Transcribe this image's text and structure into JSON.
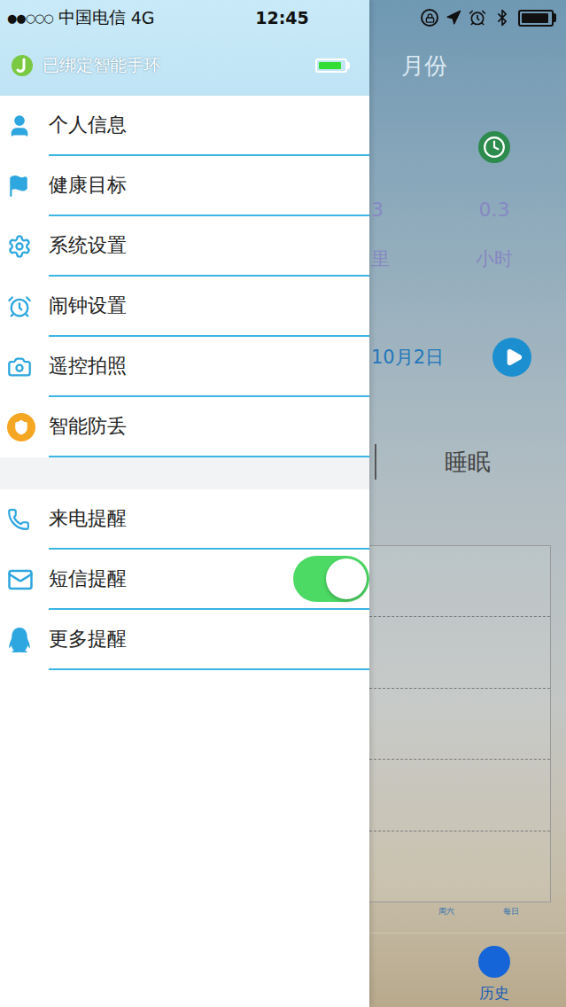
{
  "status_bar": {
    "signal": "●●○○○",
    "carrier": "中国电信",
    "network": "4G",
    "time": "12:45",
    "battery_level": 0.95
  },
  "drawer": {
    "header": {
      "label": "已绑定智能手环",
      "battery_level": 0.9
    },
    "sections": [
      {
        "items": [
          {
            "label": "个人信息",
            "kind": "link"
          },
          {
            "label": "健康目标",
            "kind": "link"
          },
          {
            "label": "系统设置",
            "kind": "link"
          },
          {
            "label": "闹钟设置",
            "kind": "link"
          },
          {
            "label": "遥控拍照",
            "kind": "link"
          },
          {
            "label": "智能防丢",
            "kind": "link"
          }
        ]
      },
      {
        "items": [
          {
            "label": "来电提醒",
            "kind": "link"
          },
          {
            "label": "短信提醒",
            "kind": "toggle",
            "on": true
          },
          {
            "label": "更多提醒",
            "kind": "link"
          }
        ]
      }
    ]
  },
  "page": {
    "title": "月份",
    "stats": [
      {
        "value": "3",
        "unit": "里"
      },
      {
        "value": "0.3",
        "unit": "小时"
      }
    ],
    "date": "10月2日",
    "tabs": [
      {
        "label": "睡眠",
        "selected": false
      }
    ],
    "chart": {
      "gridlines": 4,
      "x_labels": [
        "周六",
        "每日"
      ]
    },
    "bottom_tab": {
      "label": "历史",
      "selected": true
    }
  }
}
